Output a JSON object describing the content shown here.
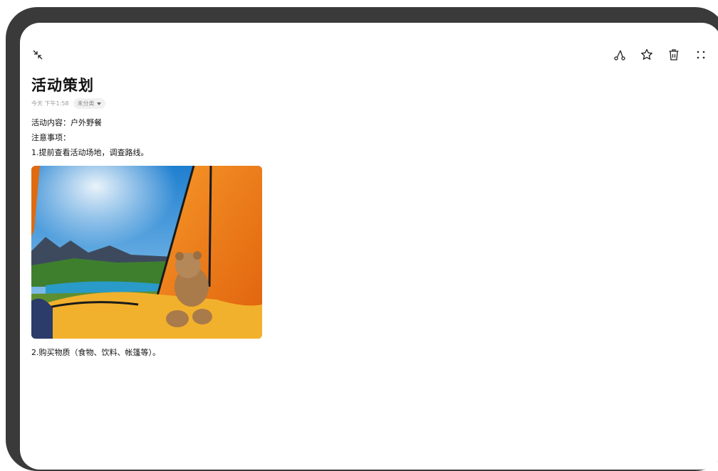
{
  "note": {
    "title": "活动策划",
    "time": "今天 下午1:58",
    "category": "未分类",
    "lines": [
      "活动内容：户外野餐",
      "注意事项：",
      "1.提前查看活动场地，调查路线。",
      "2.购买物质（食物、饮料、帐篷等）。"
    ]
  },
  "icons": {
    "collapse": "collapse-arrows-icon",
    "share": "share-icon",
    "favorite": "star-icon",
    "delete": "trash-icon",
    "more": "more-dots-icon"
  },
  "colors": {
    "frame": "#3a3a3a",
    "tent_orange": "#f07a12",
    "sky_blue": "#2f8fd6"
  }
}
